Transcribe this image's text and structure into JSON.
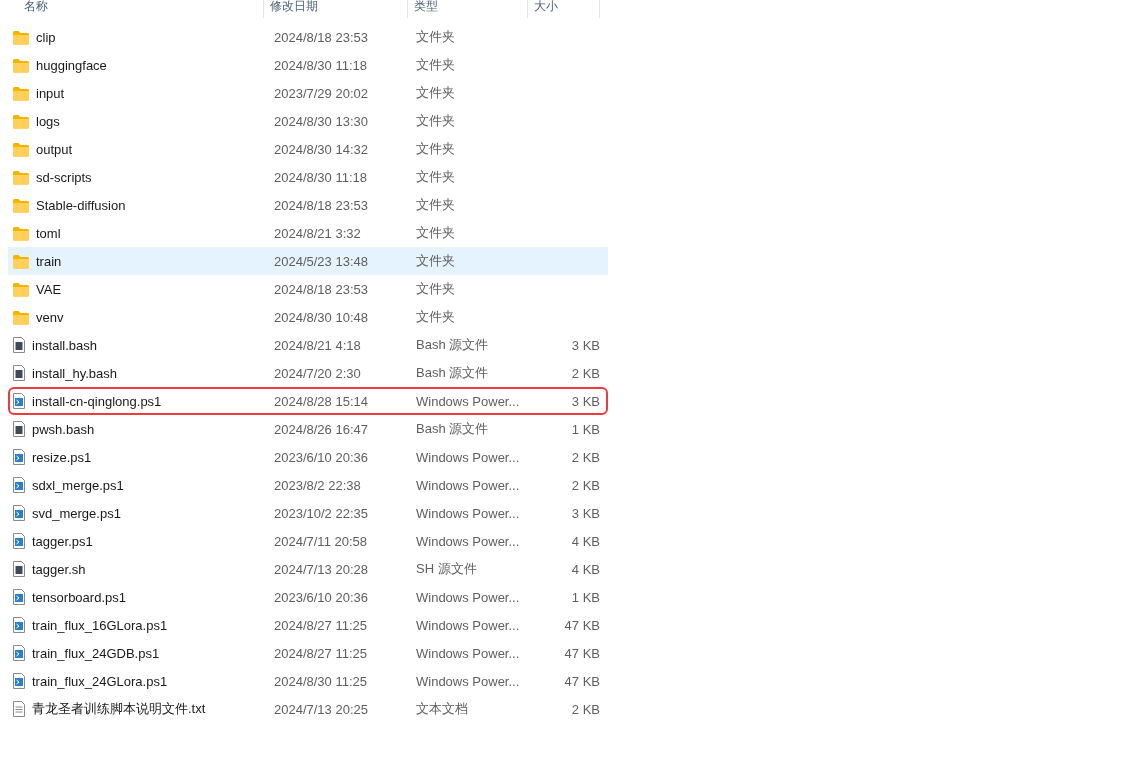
{
  "columns": [
    "名称",
    "修改日期",
    "类型",
    "大小"
  ],
  "rows": [
    {
      "kind": "folder",
      "name": "clip",
      "date": "2024/8/18 23:53",
      "type": "文件夹",
      "hovered": false,
      "outlined": false
    },
    {
      "kind": "folder",
      "name": "huggingface",
      "date": "2024/8/30 11:18",
      "type": "文件夹",
      "hovered": false,
      "outlined": false
    },
    {
      "kind": "folder",
      "name": "input",
      "date": "2023/7/29 20:02",
      "type": "文件夹",
      "hovered": false,
      "outlined": false
    },
    {
      "kind": "folder",
      "name": "logs",
      "date": "2024/8/30 13:30",
      "type": "文件夹",
      "hovered": false,
      "outlined": false
    },
    {
      "kind": "folder",
      "name": "output",
      "date": "2024/8/30 14:32",
      "type": "文件夹",
      "hovered": false,
      "outlined": false
    },
    {
      "kind": "folder",
      "name": "sd-scripts",
      "date": "2024/8/30 11:18",
      "type": "文件夹",
      "hovered": false,
      "outlined": false
    },
    {
      "kind": "folder",
      "name": "Stable-diffusion",
      "date": "2024/8/18 23:53",
      "type": "文件夹",
      "hovered": false,
      "outlined": false
    },
    {
      "kind": "folder",
      "name": "toml",
      "date": "2024/8/21 3:32",
      "type": "文件夹",
      "hovered": false,
      "outlined": false
    },
    {
      "kind": "folder",
      "name": "train",
      "date": "2024/5/23 13:48",
      "type": "文件夹",
      "hovered": true,
      "outlined": false
    },
    {
      "kind": "folder",
      "name": "VAE",
      "date": "2024/8/18 23:53",
      "type": "文件夹",
      "hovered": false,
      "outlined": false
    },
    {
      "kind": "folder",
      "name": "venv",
      "date": "2024/8/30 10:48",
      "type": "文件夹",
      "hovered": false,
      "outlined": false
    },
    {
      "kind": "shell",
      "name": "install.bash",
      "date": "2024/8/21 4:18",
      "type": "Bash 源文件",
      "size": "3 KB",
      "hovered": false,
      "outlined": false
    },
    {
      "kind": "shell",
      "name": "install_hy.bash",
      "date": "2024/7/20 2:30",
      "type": "Bash 源文件",
      "size": "2 KB",
      "hovered": false,
      "outlined": false
    },
    {
      "kind": "powershell",
      "name": "install-cn-qinglong.ps1",
      "date": "2024/8/28 15:14",
      "type": "Windows Power...",
      "size": "3 KB",
      "hovered": false,
      "outlined": true
    },
    {
      "kind": "shell",
      "name": "pwsh.bash",
      "date": "2024/8/26 16:47",
      "type": "Bash 源文件",
      "size": "1 KB",
      "hovered": false,
      "outlined": false
    },
    {
      "kind": "powershell",
      "name": "resize.ps1",
      "date": "2023/6/10 20:36",
      "type": "Windows Power...",
      "size": "2 KB",
      "hovered": false,
      "outlined": false
    },
    {
      "kind": "powershell",
      "name": "sdxl_merge.ps1",
      "date": "2023/8/2 22:38",
      "type": "Windows Power...",
      "size": "2 KB",
      "hovered": false,
      "outlined": false
    },
    {
      "kind": "powershell",
      "name": "svd_merge.ps1",
      "date": "2023/10/2 22:35",
      "type": "Windows Power...",
      "size": "3 KB",
      "hovered": false,
      "outlined": false
    },
    {
      "kind": "powershell",
      "name": "tagger.ps1",
      "date": "2024/7/11 20:58",
      "type": "Windows Power...",
      "size": "4 KB",
      "hovered": false,
      "outlined": false
    },
    {
      "kind": "shell",
      "name": "tagger.sh",
      "date": "2024/7/13 20:28",
      "type": "SH 源文件",
      "size": "4 KB",
      "hovered": false,
      "outlined": false
    },
    {
      "kind": "powershell",
      "name": "tensorboard.ps1",
      "date": "2023/6/10 20:36",
      "type": "Windows Power...",
      "size": "1 KB",
      "hovered": false,
      "outlined": false
    },
    {
      "kind": "powershell",
      "name": "train_flux_16GLora.ps1",
      "date": "2024/8/27 11:25",
      "type": "Windows Power...",
      "size": "47 KB",
      "hovered": false,
      "outlined": false
    },
    {
      "kind": "powershell",
      "name": "train_flux_24GDB.ps1",
      "date": "2024/8/27 11:25",
      "type": "Windows Power...",
      "size": "47 KB",
      "hovered": false,
      "outlined": false
    },
    {
      "kind": "powershell",
      "name": "train_flux_24GLora.ps1",
      "date": "2024/8/30 11:25",
      "type": "Windows Power...",
      "size": "47 KB",
      "hovered": false,
      "outlined": false
    },
    {
      "kind": "text",
      "name": "青龙圣者训练脚本说明文件.txt",
      "date": "2024/7/13 20:25",
      "type": "文本文档",
      "size": "2 KB",
      "hovered": false,
      "outlined": false
    }
  ]
}
